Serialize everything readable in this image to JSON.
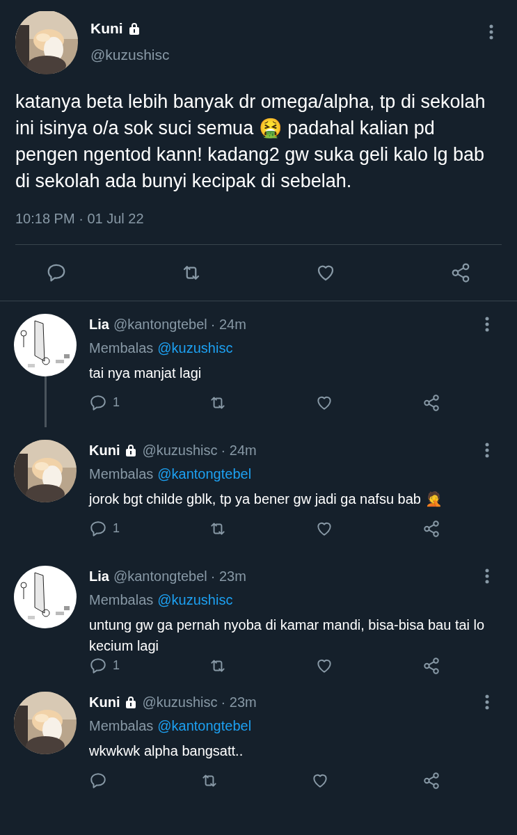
{
  "main_tweet": {
    "name": "Kuni",
    "locked": true,
    "handle": "@kuzushisc",
    "text": "katanya beta lebih banyak dr omega/alpha, tp di sekolah ini isinya o/a sok suci semua 🤮 padahal kalian pd pengen ngentod kann! kadang2 gw suka geli kalo lg bab di sekolah ada bunyi kecipak di sebelah.",
    "timestamp": "10:18 PM · 01 Jul 22"
  },
  "replies": [
    {
      "kind": "drawing",
      "name": "Lia",
      "locked": false,
      "handle": "@kantongtebel",
      "time": "· 24m",
      "reply_label": "Membalas",
      "reply_to": "@kuzushisc",
      "text": "tai nya manjat lagi",
      "reply_count": "1",
      "thread_line": true
    },
    {
      "kind": "cat",
      "name": "Kuni",
      "locked": true,
      "handle": "@kuzushisc",
      "time": "· 24m",
      "reply_label": "Membalas",
      "reply_to": "@kantongtebel",
      "text": "jorok bgt childe gblk, tp ya bener gw jadi ga nafsu bab 🤦",
      "reply_count": "1",
      "thread_line": false
    },
    {
      "kind": "drawing",
      "name": "Lia",
      "locked": false,
      "handle": "@kantongtebel",
      "time": "· 23m",
      "reply_label": "Membalas",
      "reply_to": "@kuzushisc",
      "text": "untung gw ga pernah nyoba di kamar mandi, bisa-bisa bau tai lo kecium lagi",
      "reply_count": "1",
      "thread_line": false
    },
    {
      "kind": "cat",
      "name": "Kuni",
      "locked": true,
      "handle": "@kuzushisc",
      "time": "· 23m",
      "reply_label": "Membalas",
      "reply_to": "@kantongtebel",
      "text": "wkwkwk alpha bangsatt..",
      "thread_line": false
    }
  ]
}
